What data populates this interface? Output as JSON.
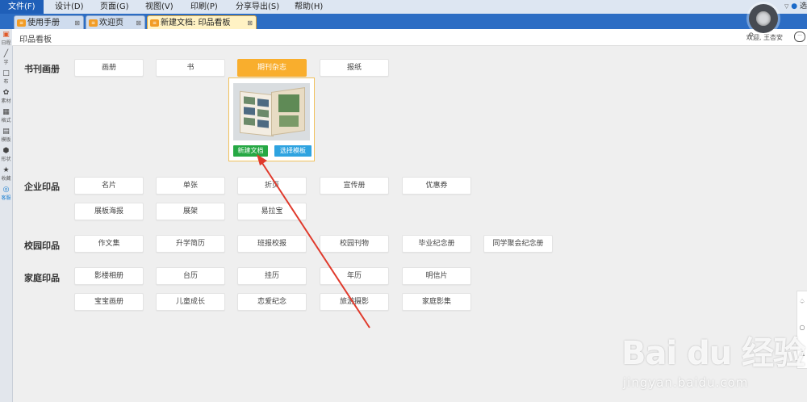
{
  "menubar": {
    "items": [
      "文件(F)",
      "设计(D)",
      "页面(G)",
      "视图(V)",
      "印刷(P)",
      "分享导出(S)",
      "帮助(H)"
    ],
    "right_text": "选"
  },
  "tabs": [
    {
      "label": "使用手册",
      "close": "⊠"
    },
    {
      "label": "欢迎页",
      "close": "⊠"
    },
    {
      "label": "新建文档: 印品看板",
      "close": "⊠"
    }
  ],
  "sidebar": {
    "items": [
      "日程",
      "字",
      "布",
      "素材",
      "格式",
      "模板",
      "形状",
      "收藏",
      "客服"
    ]
  },
  "header": {
    "title": "印品看板",
    "welcome": "欢迎, 王杏安"
  },
  "categories": [
    {
      "label": "书刊画册",
      "buttons": [
        "画册",
        "书",
        "期刊杂志",
        "报纸"
      ],
      "selected": "期刊杂志"
    },
    {
      "label": "企业印品",
      "buttons": [
        "名片",
        "单张",
        "折页",
        "宣传册",
        "优惠券",
        "展板海报",
        "展架",
        "易拉宝"
      ]
    },
    {
      "label": "校园印品",
      "buttons": [
        "作文集",
        "升学简历",
        "班报校报",
        "校园刊物",
        "毕业纪念册",
        "同学聚会纪念册"
      ]
    },
    {
      "label": "家庭印品",
      "buttons": [
        "影楼相册",
        "台历",
        "挂历",
        "年历",
        "明信片",
        "宝宝画册",
        "儿童成长",
        "恋爱纪念",
        "旅游摄影",
        "家庭影集"
      ]
    }
  ],
  "popup": {
    "new_button": "新建文档",
    "template_button": "选择模板"
  },
  "watermark": {
    "logo": "Bai du 经验",
    "url": "jingyan.baidu.com"
  },
  "colors": {
    "selected": "#f9ae2d",
    "new_doc": "#26a844",
    "choose_template": "#2ea3e0",
    "annotation_arrow": "#e03a2c"
  }
}
